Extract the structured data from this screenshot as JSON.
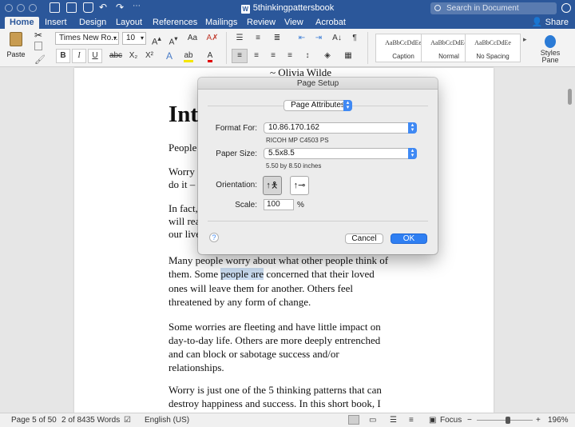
{
  "titlebar": {
    "document_title": "5thinkingpattersbook",
    "search_placeholder": "Search in Document"
  },
  "ribbon_tabs": [
    "Home",
    "Insert",
    "Design",
    "Layout",
    "References",
    "Mailings",
    "Review",
    "View",
    "Acrobat"
  ],
  "share_label": "Share",
  "ribbon": {
    "paste_label": "Paste",
    "font_name": "Times New Ro...",
    "font_size": "10",
    "bold": "B",
    "italic": "I",
    "underline": "U",
    "strike": "abc",
    "subscript": "X₂",
    "superscript": "X²",
    "styles": [
      {
        "sample": "AaBbCcDdEe",
        "name": "Caption"
      },
      {
        "sample": "AaBbCcDdEe",
        "name": "Normal"
      },
      {
        "sample": "AaBbCcDdEe",
        "name": "No Spacing"
      }
    ],
    "styles_pane_label": "Styles\nPane"
  },
  "document": {
    "quote": "~ Olivia Wilde",
    "heading": "Int",
    "p1": "People",
    "p2_l1": "Worry",
    "p2_l2": "do it –",
    "p3_l1": "In fact,",
    "p3_l2": "will rea",
    "p3_l3": "our live",
    "p4_l1": "Many people worry about what other people think of",
    "p4_l2_a": "them.  Some ",
    "p4_l2_sel": "people are",
    "p4_l2_b": " concerned that their loved",
    "p4_l3": "ones will leave them for another.  Others feel",
    "p4_l4": "threatened by any form of change.",
    "p5_l1": "Some worries are fleeting and have little impact on",
    "p5_l2": "day-to-day life.  Others are more deeply entrenched",
    "p5_l3": "and can block or sabotage success and/or",
    "p5_l4": "relationships.",
    "p6_l1": "Worry is just one of the 5 thinking patterns that can",
    "p6_l2": "destroy happiness and success.  In this short book, I"
  },
  "status": {
    "page": "Page 5 of 50",
    "words": "2 of 8435 Words",
    "language": "English (US)",
    "focus": "Focus",
    "zoom": "196%"
  },
  "dialog": {
    "title": "Page Setup",
    "section": "Page Attributes",
    "format_for_label": "Format For:",
    "format_for_value": "10.86.170.162",
    "format_for_sub": "RICOH MP C4503 PS",
    "paper_size_label": "Paper Size:",
    "paper_size_value": "5.5x8.5",
    "paper_size_sub": "5.50 by 8.50 inches",
    "orientation_label": "Orientation:",
    "scale_label": "Scale:",
    "scale_value": "100",
    "scale_unit": "%",
    "help": "?",
    "cancel": "Cancel",
    "ok": "OK"
  }
}
